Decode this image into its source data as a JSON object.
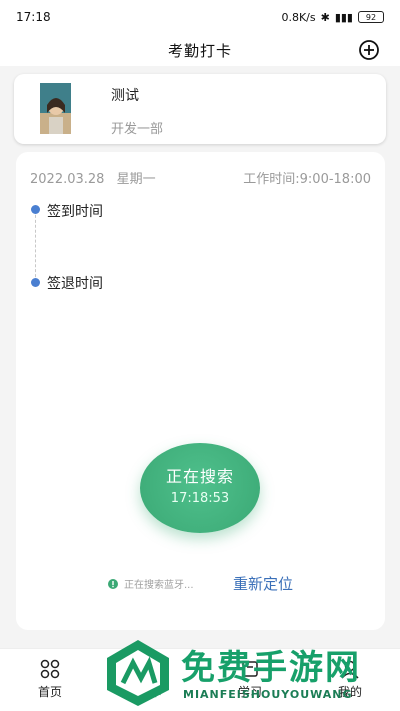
{
  "status_bar": {
    "time": "17:18",
    "network_speed": "0.8K/s",
    "battery": "92"
  },
  "header": {
    "title": "考勤打卡"
  },
  "profile": {
    "name": "测试",
    "department": "开发一部"
  },
  "attendance": {
    "date": "2022.03.28",
    "weekday": "星期一",
    "work_hours": "工作时间:9:00-18:00",
    "check_in_label": "签到时间",
    "check_out_label": "签退时间",
    "timeline_color": "#4a7fd1"
  },
  "clock_button": {
    "title": "正在搜索",
    "time": "17:18:53",
    "color": "#3aa874"
  },
  "footer_actions": {
    "hint": "正在搜索蓝牙...",
    "relocate": "重新定位"
  },
  "tabs": [
    {
      "label": "首页",
      "icon": "grid-icon"
    },
    {
      "label": "打卡",
      "icon": "clock-icon"
    },
    {
      "label": "学习",
      "icon": "book-icon"
    },
    {
      "label": "我的",
      "icon": "user-icon"
    }
  ],
  "watermark": {
    "title": "免费手游网",
    "subtitle": "MIANFEISHOUYOUWANG"
  }
}
